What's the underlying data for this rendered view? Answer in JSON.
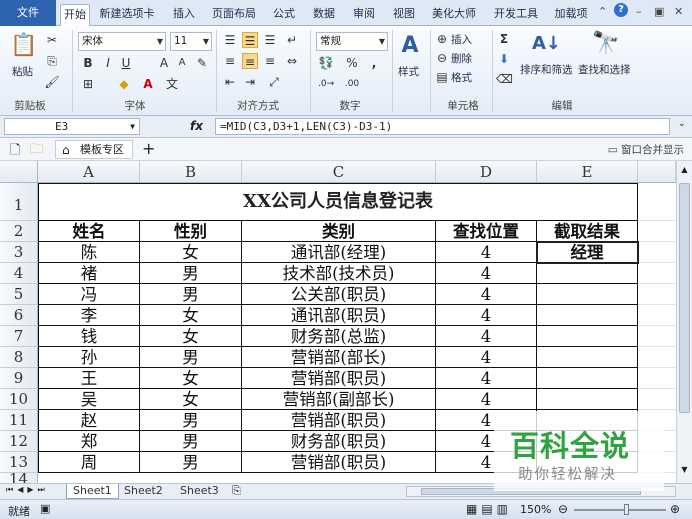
{
  "tabs": {
    "file": "文件",
    "home": "开始",
    "newtab": "新建选项卡",
    "insert": "插入",
    "layout": "页面布局",
    "formula": "公式",
    "data": "数据",
    "review": "审阅",
    "view": "视图",
    "beauty": "美化大师",
    "dev": "开发工具",
    "addins": "加载项"
  },
  "ribbon": {
    "paste": "粘贴",
    "clipboard": "剪贴板",
    "font_name": "宋体",
    "font_size": "11",
    "font_group": "字体",
    "align_group": "对齐方式",
    "num_format": "常规",
    "num_group": "数字",
    "styles": "样式",
    "insert": "插入",
    "delete": "删除",
    "format": "格式",
    "cells_group": "单元格",
    "sort_filter": "排序和筛选",
    "find_select": "查找和选择",
    "edit_group": "编辑"
  },
  "formula_bar": {
    "name_box": "E3",
    "fx": "fx",
    "formula": "=MID(C3,D3+1,LEN(C3)-D3-1)"
  },
  "doc_tabs": {
    "template": "模板专区",
    "merge_window": "窗口合并显示"
  },
  "grid": {
    "columns": [
      "A",
      "B",
      "C",
      "D",
      "E"
    ],
    "rows": [
      "1",
      "2",
      "3",
      "4",
      "5",
      "6",
      "7",
      "8",
      "9",
      "10",
      "11",
      "12",
      "13",
      "14"
    ],
    "title": "XX公司人员信息登记表",
    "headers": [
      "姓名",
      "性别",
      "类别",
      "查找位置",
      "截取结果"
    ],
    "data": [
      [
        "陈",
        "女",
        "通讯部(经理)",
        "4",
        "经理"
      ],
      [
        "褚",
        "男",
        "技术部(技术员)",
        "4",
        ""
      ],
      [
        "冯",
        "男",
        "公关部(职员)",
        "4",
        ""
      ],
      [
        "李",
        "女",
        "通讯部(职员)",
        "4",
        ""
      ],
      [
        "钱",
        "女",
        "财务部(总监)",
        "4",
        ""
      ],
      [
        "孙",
        "男",
        "营销部(部长)",
        "4",
        ""
      ],
      [
        "王",
        "女",
        "营销部(职员)",
        "4",
        ""
      ],
      [
        "吴",
        "女",
        "营销部(副部长)",
        "4",
        ""
      ],
      [
        "赵",
        "男",
        "营销部(职员)",
        "4",
        ""
      ],
      [
        "郑",
        "男",
        "财务部(职员)",
        "4",
        ""
      ],
      [
        "周",
        "男",
        "营销部(职员)",
        "4",
        ""
      ]
    ]
  },
  "sheets": [
    "Sheet1",
    "Sheet2",
    "Sheet3"
  ],
  "status": {
    "ready": "就绪",
    "zoom": "150%"
  },
  "watermark": {
    "title": "百科全说",
    "subtitle": "助你轻松解决"
  }
}
